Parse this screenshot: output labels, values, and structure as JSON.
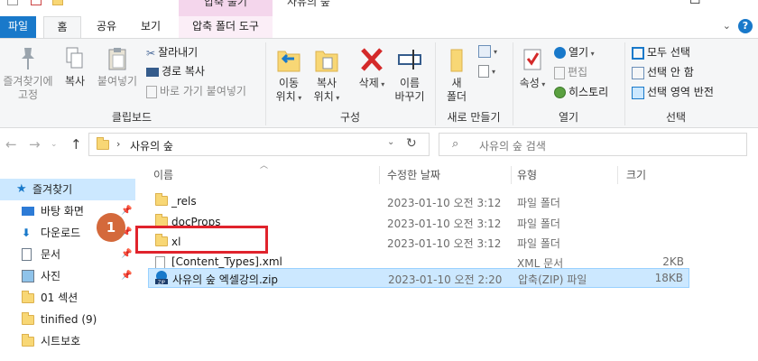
{
  "titlebar": {
    "context_tab_group": "압축 풀기",
    "window_title": "사유의 숲",
    "minimize": "─",
    "maximize": "☐"
  },
  "tabs": {
    "file": "파일",
    "home": "홈",
    "share": "공유",
    "view": "보기",
    "context_tool": "압축 폴더 도구"
  },
  "ribbon": {
    "clipboard": {
      "pin_to_quick": "즐겨찾기에\n고정",
      "copy": "복사",
      "paste": "붙여넣기",
      "cut": "잘라내기",
      "copy_path": "경로 복사",
      "paste_shortcut": "바로 가기 붙여넣기",
      "group": "클립보드"
    },
    "organize": {
      "move_to": "이동\n위치",
      "copy_to": "복사\n위치",
      "delete": "삭제",
      "rename": "이름\n바꾸기",
      "group": "구성"
    },
    "new": {
      "new_folder": "새\n폴더",
      "group": "새로 만들기"
    },
    "open": {
      "properties": "속성",
      "open": "열기",
      "edit": "편집",
      "history": "히스토리",
      "group": "열기"
    },
    "select": {
      "select_all": "모두 선택",
      "select_none": "선택 안 함",
      "invert": "선택 영역 반전",
      "group": "선택"
    }
  },
  "navbar": {
    "back": "←",
    "forward": "→",
    "up": "↑",
    "path": "사유의 숲",
    "search_placeholder": "사유의 숲 검색"
  },
  "sidebar": {
    "items": [
      {
        "label": "즐겨찾기",
        "icon": "star-icon",
        "pinned": false
      },
      {
        "label": "바탕 화면",
        "icon": "desktop-icon",
        "pinned": true
      },
      {
        "label": "다운로드",
        "icon": "download-icon",
        "pinned": true
      },
      {
        "label": "문서",
        "icon": "document-icon",
        "pinned": true
      },
      {
        "label": "사진",
        "icon": "picture-icon",
        "pinned": true
      },
      {
        "label": "01 섹션",
        "icon": "folder-icon",
        "pinned": false
      },
      {
        "label": "tinified (9)",
        "icon": "folder-icon",
        "pinned": false
      },
      {
        "label": "시트보호",
        "icon": "folder-icon",
        "pinned": false
      }
    ]
  },
  "filelist": {
    "columns": {
      "name": "이름",
      "date": "수정한 날짜",
      "type": "유형",
      "size": "크기"
    },
    "rows": [
      {
        "name": "_rels",
        "date": "2023-01-10 오전 3:12",
        "type": "파일 폴더",
        "size": "",
        "kind": "folder"
      },
      {
        "name": "docProps",
        "date": "2023-01-10 오전 3:12",
        "type": "파일 폴더",
        "size": "",
        "kind": "folder"
      },
      {
        "name": "xl",
        "date": "2023-01-10 오전 3:12",
        "type": "파일 폴더",
        "size": "",
        "kind": "folder"
      },
      {
        "name": "[Content_Types].xml",
        "date": "",
        "type": "XML 문서",
        "size": "2KB",
        "kind": "xml"
      },
      {
        "name": "사유의 숲 엑셀강의.zip",
        "date": "2023-01-10 오전 2:20",
        "type": "압축(ZIP) 파일",
        "size": "18KB",
        "kind": "zip"
      }
    ]
  },
  "annotation": {
    "step": "1"
  },
  "colors": {
    "accent": "#1979ca",
    "highlight": "#e0232c",
    "badge": "#d4693b",
    "selection": "#cce8ff"
  }
}
